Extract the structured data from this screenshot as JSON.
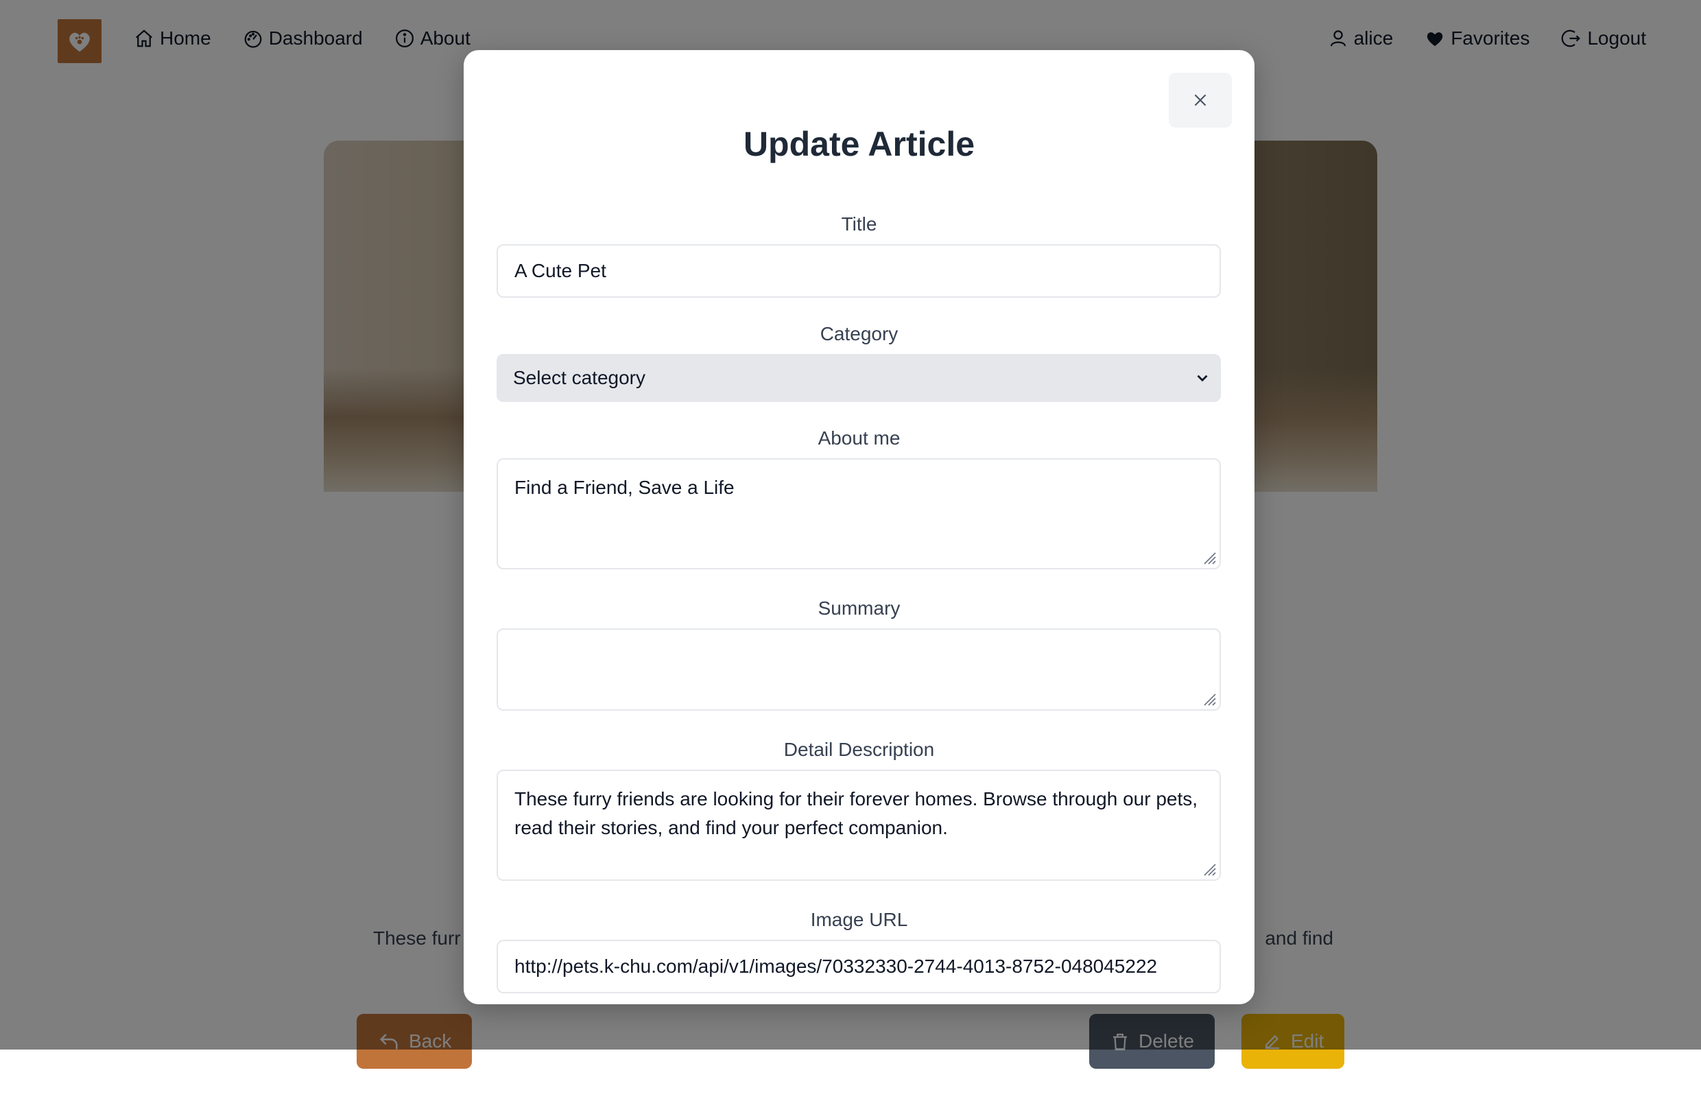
{
  "nav": {
    "logo_icon": "heart-paw-logo",
    "left_links": [
      {
        "label": "Home",
        "icon": "home-icon"
      },
      {
        "label": "Dashboard",
        "icon": "dashboard-icon"
      },
      {
        "label": "About",
        "icon": "info-icon"
      }
    ],
    "right_links": [
      {
        "label": "alice",
        "icon": "user-icon"
      },
      {
        "label": "Favorites",
        "icon": "heart-icon"
      },
      {
        "label": "Logout",
        "icon": "logout-icon"
      }
    ]
  },
  "page": {
    "article_text_visible": "These furr",
    "article_text_tail": "and find",
    "back_label": "Back",
    "delete_label": "Delete",
    "edit_label": "Edit"
  },
  "modal": {
    "title": "Update Article",
    "close_icon": "close-icon",
    "fields": {
      "title_label": "Title",
      "title_value": "A Cute Pet",
      "category_label": "Category",
      "category_value": "Select category",
      "about_label": "About me",
      "about_value": "Find a Friend, Save a Life",
      "summary_label": "Summary",
      "summary_value": "",
      "detail_label": "Detail Description",
      "detail_value": "These furry friends are looking for their forever homes. Browse through our pets, read their stories, and find your perfect companion.",
      "image_label": "Image URL",
      "image_value": "http://pets.k-chu.com/api/v1/images/70332330-2744-4013-8752-048045222"
    }
  },
  "colors": {
    "brand": "#c0743a",
    "delete": "#4b5563",
    "edit": "#eab308",
    "overlay": "rgba(0,0,0,0.5)"
  }
}
